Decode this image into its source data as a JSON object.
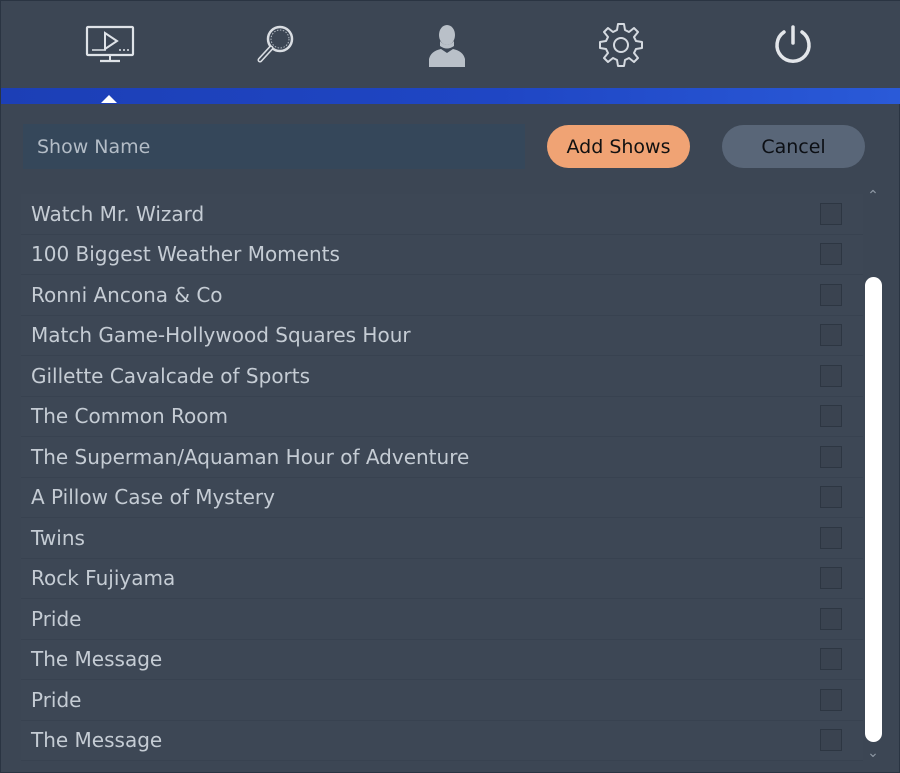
{
  "nav": {
    "items": [
      {
        "name": "tv-icon",
        "active": true
      },
      {
        "name": "search-icon",
        "active": false
      },
      {
        "name": "user-icon",
        "active": false
      },
      {
        "name": "gear-icon",
        "active": false
      },
      {
        "name": "power-icon",
        "active": false
      }
    ],
    "accent_color": "#1f46c4"
  },
  "toolbar": {
    "search_placeholder": "Show Name",
    "search_value": "",
    "add_label": "Add Shows",
    "cancel_label": "Cancel",
    "add_color": "#f0a374",
    "cancel_color": "#596678"
  },
  "shows": [
    {
      "title": "Watch Mr. Wizard",
      "checked": false
    },
    {
      "title": "100 Biggest Weather Moments",
      "checked": false
    },
    {
      "title": "Ronni Ancona & Co",
      "checked": false
    },
    {
      "title": "Match Game-Hollywood Squares Hour",
      "checked": false
    },
    {
      "title": "Gillette Cavalcade of Sports",
      "checked": false
    },
    {
      "title": "The Common Room",
      "checked": false
    },
    {
      "title": "The Superman/Aquaman Hour of Adventure",
      "checked": false
    },
    {
      "title": "A Pillow Case of Mystery",
      "checked": false
    },
    {
      "title": "Twins",
      "checked": false
    },
    {
      "title": "Rock Fujiyama",
      "checked": false
    },
    {
      "title": "Pride",
      "checked": false
    },
    {
      "title": "The Message",
      "checked": false
    },
    {
      "title": "Pride",
      "checked": false
    },
    {
      "title": "The Message",
      "checked": false
    }
  ]
}
